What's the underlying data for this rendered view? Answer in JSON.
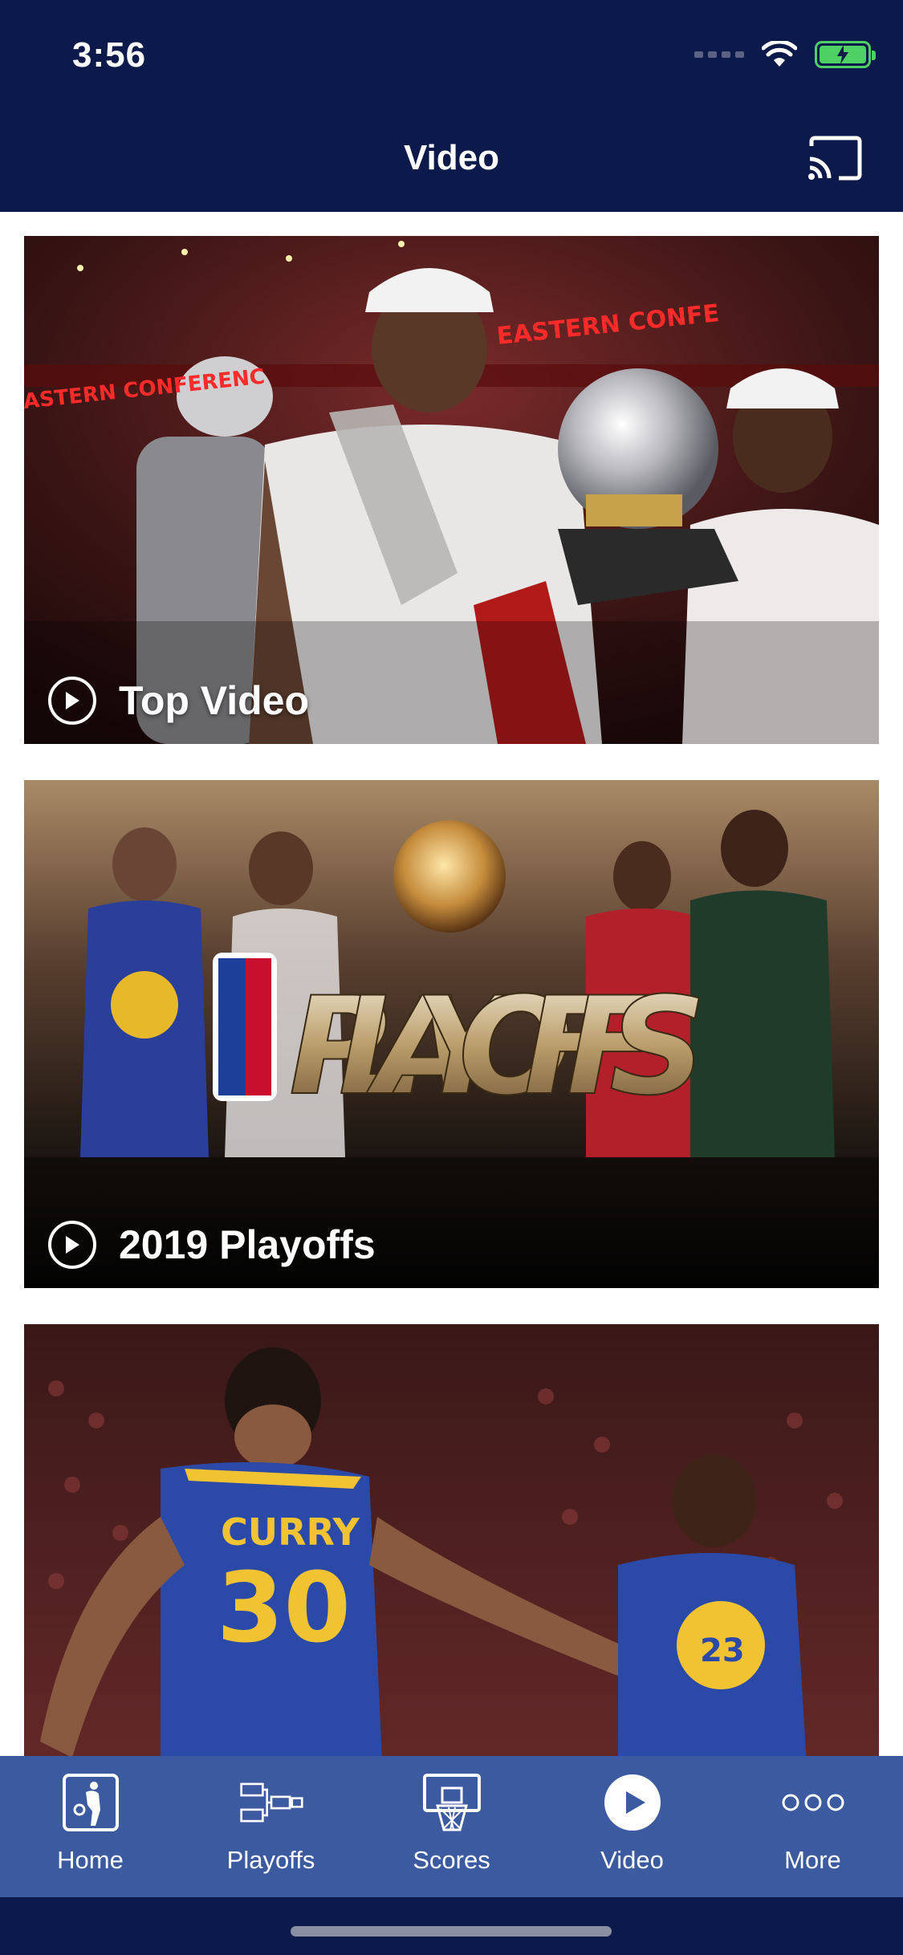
{
  "status": {
    "time": "3:56"
  },
  "header": {
    "title": "Video"
  },
  "cards": [
    {
      "label": "Top Video"
    },
    {
      "label": "2019 Playoffs"
    },
    {
      "label": ""
    }
  ],
  "tabs": [
    {
      "label": "Home",
      "icon": "nba-logo-icon"
    },
    {
      "label": "Playoffs",
      "icon": "bracket-icon"
    },
    {
      "label": "Scores",
      "icon": "basketball-hoop-icon"
    },
    {
      "label": "Video",
      "icon": "play-circle-icon",
      "active": true
    },
    {
      "label": "More",
      "icon": "more-dots-icon"
    }
  ],
  "colors": {
    "header_bg": "#0c1a4b",
    "tabbar_bg": "#3b5aa0",
    "battery": "#4fd064"
  }
}
